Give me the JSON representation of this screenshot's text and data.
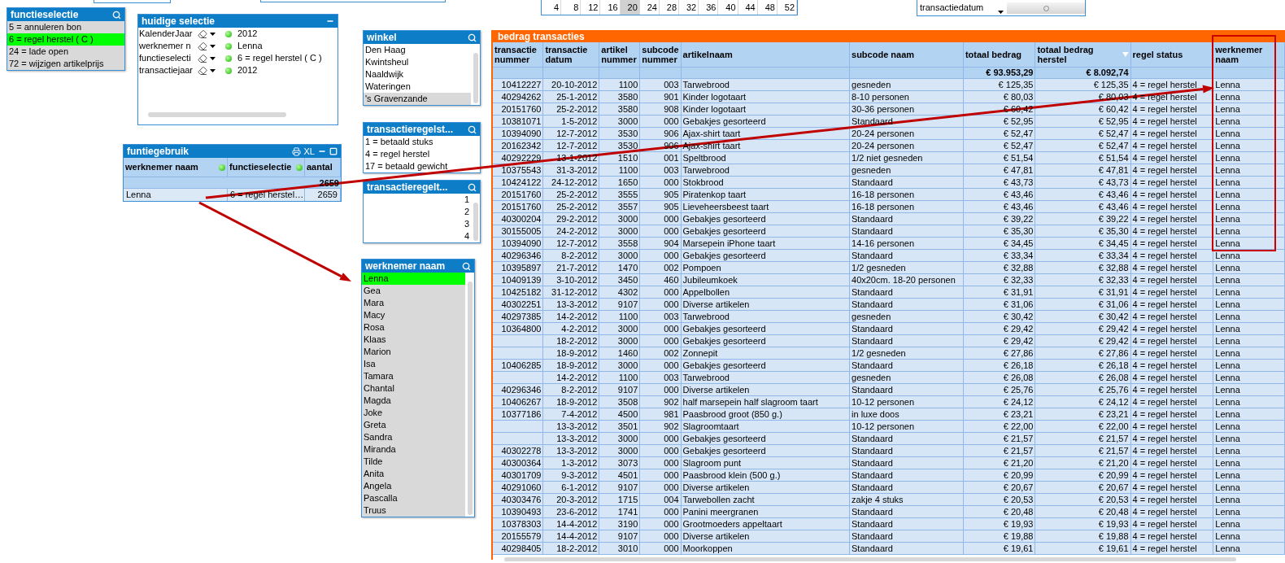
{
  "week_numbers": [
    {
      "label": "4",
      "selected": false
    },
    {
      "label": "8",
      "selected": false
    },
    {
      "label": "12",
      "selected": false
    },
    {
      "label": "16",
      "selected": false
    },
    {
      "label": "20",
      "selected": true
    },
    {
      "label": "24",
      "selected": false
    },
    {
      "label": "28",
      "selected": false
    },
    {
      "label": "32",
      "selected": false
    },
    {
      "label": "36",
      "selected": false
    },
    {
      "label": "40",
      "selected": false
    },
    {
      "label": "44",
      "selected": false
    },
    {
      "label": "48",
      "selected": false
    },
    {
      "label": "52",
      "selected": false
    }
  ],
  "date_field": {
    "label": "transactiedatum"
  },
  "functieselectie": {
    "title": "functieselectie",
    "items": [
      {
        "label": "5 = annuleren bon",
        "selected": false,
        "excluded": true
      },
      {
        "label": "6 = regel herstel ( C )",
        "selected": true,
        "excluded": false
      },
      {
        "label": "24 = lade open",
        "selected": false,
        "excluded": true
      },
      {
        "label": "72 = wijzigen artikelprijs",
        "selected": false,
        "excluded": true
      }
    ]
  },
  "huidige_selectie": {
    "title": "huidige selectie",
    "rows": [
      {
        "field": "KalenderJaar",
        "value": "2012"
      },
      {
        "field": "werknemer n",
        "value": "Lenna"
      },
      {
        "field": "functieselecti",
        "value": "6 = regel herstel ( C )"
      },
      {
        "field": "transactiejaar",
        "value": "2012"
      }
    ]
  },
  "winkel": {
    "title": "winkel",
    "items": [
      {
        "label": "Den Haag",
        "selected": false,
        "excluded": false
      },
      {
        "label": "Kwintsheul",
        "selected": false,
        "excluded": false
      },
      {
        "label": "Naaldwijk",
        "selected": false,
        "excluded": false
      },
      {
        "label": "Wateringen",
        "selected": false,
        "excluded": false
      },
      {
        "label": "'s Gravenzande",
        "selected": false,
        "excluded": true
      }
    ]
  },
  "transactieregelstatus": {
    "title": "transactieregelst...",
    "items": [
      {
        "label": "1 = betaald stuks",
        "selected": false,
        "excluded": false
      },
      {
        "label": "4 = regel herstel",
        "selected": false,
        "excluded": false
      },
      {
        "label": "17 = betaald gewicht",
        "selected": false,
        "excluded": false
      }
    ]
  },
  "transactieregeltype": {
    "title": "transactieregelt...",
    "items": [
      {
        "label": "1",
        "selected": false,
        "excluded": false
      },
      {
        "label": "2",
        "selected": false,
        "excluded": false
      },
      {
        "label": "3",
        "selected": false,
        "excluded": false
      },
      {
        "label": "4",
        "selected": false,
        "excluded": false
      }
    ]
  },
  "funtiegebruik": {
    "title": "funtiegebruik",
    "export_label": "XL",
    "columns": [
      "werknemer naam",
      "functieselectie",
      "aantal"
    ],
    "total": "2659",
    "rows": [
      [
        "Lenna",
        "6 = regel herstel…",
        "2659"
      ]
    ]
  },
  "werknemer_naam": {
    "title": "werknemer naam",
    "items": [
      {
        "label": "Lenna",
        "selected": true,
        "excluded": false
      },
      {
        "label": "Gea",
        "selected": false,
        "excluded": true
      },
      {
        "label": "Mara",
        "selected": false,
        "excluded": true
      },
      {
        "label": "Macy",
        "selected": false,
        "excluded": true
      },
      {
        "label": "Rosa",
        "selected": false,
        "excluded": true
      },
      {
        "label": "Klaas",
        "selected": false,
        "excluded": true
      },
      {
        "label": "Marion",
        "selected": false,
        "excluded": true
      },
      {
        "label": "Isa",
        "selected": false,
        "excluded": true
      },
      {
        "label": "Tamara",
        "selected": false,
        "excluded": true
      },
      {
        "label": "Chantal",
        "selected": false,
        "excluded": true
      },
      {
        "label": "Magda",
        "selected": false,
        "excluded": true
      },
      {
        "label": "Joke",
        "selected": false,
        "excluded": true
      },
      {
        "label": "Greta",
        "selected": false,
        "excluded": true
      },
      {
        "label": "Sandra",
        "selected": false,
        "excluded": true
      },
      {
        "label": "Miranda",
        "selected": false,
        "excluded": true
      },
      {
        "label": "Tilde",
        "selected": false,
        "excluded": true
      },
      {
        "label": "Anita",
        "selected": false,
        "excluded": true
      },
      {
        "label": "Angela",
        "selected": false,
        "excluded": true
      },
      {
        "label": "Pascalla",
        "selected": false,
        "excluded": true
      },
      {
        "label": "Truus",
        "selected": false,
        "excluded": true
      }
    ]
  },
  "transactions": {
    "title": "bedrag transacties",
    "columns": [
      {
        "label": "transactie nummer",
        "kind": "number",
        "sorted": false
      },
      {
        "label": "transactie datum",
        "kind": "number",
        "sorted": false
      },
      {
        "label": "artikel nummer",
        "kind": "number",
        "sorted": false
      },
      {
        "label": "subcode nummer",
        "kind": "number",
        "sorted": false
      },
      {
        "label": "artikelnaam",
        "kind": "text",
        "sorted": false
      },
      {
        "label": "subcode naam",
        "kind": "text",
        "sorted": false
      },
      {
        "label": "totaal bedrag",
        "kind": "number",
        "total": "€ 93.953,29",
        "sorted": false
      },
      {
        "label": "totaal bedrag herstel",
        "kind": "number",
        "total": "€ 8.092,74",
        "sorted": true
      },
      {
        "label": "regel status",
        "kind": "text",
        "sorted": false
      },
      {
        "label": "werknemer naam",
        "kind": "text",
        "sorted": false
      }
    ],
    "rows": [
      [
        "10412227",
        "20-10-2012",
        "1100",
        "003",
        "Tarwebrood",
        "gesneden",
        "€ 125,35",
        "€ 125,35",
        "4 = regel herstel",
        "Lenna"
      ],
      [
        "40294262",
        "25-1-2012",
        "3580",
        "901",
        "Kinder logotaart",
        "8-10 personen",
        "€ 80,03",
        "€ 80,03",
        "4 = regel herstel",
        "Lenna"
      ],
      [
        "20151760",
        "25-2-2012",
        "3580",
        "908",
        "Kinder logotaart",
        "30-36 personen",
        "€ 60,42",
        "€ 60,42",
        "4 = regel herstel",
        "Lenna"
      ],
      [
        "10381071",
        "1-5-2012",
        "3000",
        "000",
        "Gebakjes gesorteerd",
        "Standaard",
        "€ 52,95",
        "€ 52,95",
        "4 = regel herstel",
        "Lenna"
      ],
      [
        "10394090",
        "12-7-2012",
        "3530",
        "906",
        "Ajax-shirt taart",
        "20-24 personen",
        "€ 52,47",
        "€ 52,47",
        "4 = regel herstel",
        "Lenna"
      ],
      [
        "20162342",
        "12-7-2012",
        "3530",
        "906",
        "Ajax-shirt taart",
        "20-24 personen",
        "€ 52,47",
        "€ 52,47",
        "4 = regel herstel",
        "Lenna"
      ],
      [
        "40292229",
        "13-1-2012",
        "1510",
        "001",
        "Speltbrood",
        "1/2  niet gesneden",
        "€ 51,54",
        "€ 51,54",
        "4 = regel herstel",
        "Lenna"
      ],
      [
        "10375543",
        "31-3-2012",
        "1100",
        "003",
        "Tarwebrood",
        "gesneden",
        "€ 47,81",
        "€ 47,81",
        "4 = regel herstel",
        "Lenna"
      ],
      [
        "10424122",
        "24-12-2012",
        "1650",
        "000",
        "Stokbrood",
        "Standaard",
        "€ 43,73",
        "€ 43,73",
        "4 = regel herstel",
        "Lenna"
      ],
      [
        "20151760",
        "25-2-2012",
        "3555",
        "905",
        "Piratenkop taart",
        "16-18 personen",
        "€ 43,46",
        "€ 43,46",
        "4 = regel herstel",
        "Lenna"
      ],
      [
        "20151760",
        "25-2-2012",
        "3557",
        "905",
        "Lieveheersbeest taart",
        "16-18 personen",
        "€ 43,46",
        "€ 43,46",
        "4 = regel herstel",
        "Lenna"
      ],
      [
        "40300204",
        "29-2-2012",
        "3000",
        "000",
        "Gebakjes gesorteerd",
        "Standaard",
        "€ 39,22",
        "€ 39,22",
        "4 = regel herstel",
        "Lenna"
      ],
      [
        "30155005",
        "24-2-2012",
        "3000",
        "000",
        "Gebakjes gesorteerd",
        "Standaard",
        "€ 35,30",
        "€ 35,30",
        "4 = regel herstel",
        "Lenna"
      ],
      [
        "10394090",
        "12-7-2012",
        "3558",
        "904",
        "Marsepein iPhone taart",
        "14-16 personen",
        "€ 34,45",
        "€ 34,45",
        "4 = regel herstel",
        "Lenna"
      ],
      [
        "40296346",
        "8-2-2012",
        "3000",
        "000",
        "Gebakjes gesorteerd",
        "Standaard",
        "€ 33,34",
        "€ 33,34",
        "4 = regel herstel",
        "Lenna"
      ],
      [
        "10395897",
        "21-7-2012",
        "1470",
        "002",
        "Pompoen",
        "1/2 gesneden",
        "€ 32,88",
        "€ 32,88",
        "4 = regel herstel",
        "Lenna"
      ],
      [
        "10409139",
        "3-10-2012",
        "3450",
        "460",
        "Jubileumkoek",
        "40x20cm. 18-20 personen",
        "€ 32,33",
        "€ 32,33",
        "4 = regel herstel",
        "Lenna"
      ],
      [
        "10425182",
        "31-12-2012",
        "4302",
        "000",
        "Appelbollen",
        "Standaard",
        "€ 31,91",
        "€ 31,91",
        "4 = regel herstel",
        "Lenna"
      ],
      [
        "40302251",
        "13-3-2012",
        "9107",
        "000",
        "Diverse artikelen",
        "Standaard",
        "€ 31,06",
        "€ 31,06",
        "4 = regel herstel",
        "Lenna"
      ],
      [
        "40297385",
        "14-2-2012",
        "1100",
        "003",
        "Tarwebrood",
        "gesneden",
        "€ 30,42",
        "€ 30,42",
        "4 = regel herstel",
        "Lenna"
      ],
      [
        "10364800",
        "4-2-2012",
        "3000",
        "000",
        "Gebakjes gesorteerd",
        "Standaard",
        "€ 29,42",
        "€ 29,42",
        "4 = regel herstel",
        "Lenna"
      ],
      [
        null,
        "18-2-2012",
        "3000",
        "000",
        "Gebakjes gesorteerd",
        "Standaard",
        "€ 29,42",
        "€ 29,42",
        "4 = regel herstel",
        "Lenna"
      ],
      [
        null,
        "18-9-2012",
        "1460",
        "002",
        "Zonnepit",
        "1/2 gesneden",
        "€ 27,86",
        "€ 27,86",
        "4 = regel herstel",
        "Lenna"
      ],
      [
        "10406285",
        "18-9-2012",
        "3000",
        "000",
        "Gebakjes gesorteerd",
        "Standaard",
        "€ 26,18",
        "€ 26,18",
        "4 = regel herstel",
        "Lenna"
      ],
      [
        null,
        "14-2-2012",
        "1100",
        "003",
        "Tarwebrood",
        "gesneden",
        "€ 26,08",
        "€ 26,08",
        "4 = regel herstel",
        "Lenna"
      ],
      [
        "40296346",
        "8-2-2012",
        "9107",
        "000",
        "Diverse artikelen",
        "Standaard",
        "€ 25,76",
        "€ 25,76",
        "4 = regel herstel",
        "Lenna"
      ],
      [
        "10406267",
        "18-9-2012",
        "3508",
        "902",
        "half marsepein half slagroom taart",
        "10-12 personen",
        "€ 24,12",
        "€ 24,12",
        "4 = regel herstel",
        "Lenna"
      ],
      [
        "10377186",
        "7-4-2012",
        "4500",
        "981",
        "Paasbrood groot (850 g.)",
        "in luxe doos",
        "€ 23,21",
        "€ 23,21",
        "4 = regel herstel",
        "Lenna"
      ],
      [
        null,
        "13-3-2012",
        "3501",
        "902",
        "Slagroomtaart",
        "10-12 personen",
        "€ 22,00",
        "€ 22,00",
        "4 = regel herstel",
        "Lenna"
      ],
      [
        null,
        "13-3-2012",
        "3000",
        "000",
        "Gebakjes gesorteerd",
        "Standaard",
        "€ 21,57",
        "€ 21,57",
        "4 = regel herstel",
        "Lenna"
      ],
      [
        "40302278",
        "13-3-2012",
        "3000",
        "000",
        "Gebakjes gesorteerd",
        "Standaard",
        "€ 21,57",
        "€ 21,57",
        "4 = regel herstel",
        "Lenna"
      ],
      [
        "40300364",
        "1-3-2012",
        "3073",
        "000",
        "Slagroom punt",
        "Standaard",
        "€ 21,20",
        "€ 21,20",
        "4 = regel herstel",
        "Lenna"
      ],
      [
        "40301709",
        "9-3-2012",
        "4501",
        "000",
        "Paasbrood klein (500 g.)",
        "Standaard",
        "€ 20,99",
        "€ 20,99",
        "4 = regel herstel",
        "Lenna"
      ],
      [
        "40291060",
        "6-1-2012",
        "9107",
        "000",
        "Diverse artikelen",
        "Standaard",
        "€ 20,67",
        "€ 20,67",
        "4 = regel herstel",
        "Lenna"
      ],
      [
        "40303476",
        "20-3-2012",
        "1715",
        "004",
        "Tarwebollen zacht",
        "zakje 4 stuks",
        "€ 20,53",
        "€ 20,53",
        "4 = regel herstel",
        "Lenna"
      ],
      [
        "10390493",
        "23-6-2012",
        "1741",
        "000",
        "Panini meergranen",
        "Standaard",
        "€ 20,48",
        "€ 20,48",
        "4 = regel herstel",
        "Lenna"
      ],
      [
        "10378303",
        "14-4-2012",
        "3190",
        "000",
        "Grootmoeders appeltaart",
        "Standaard",
        "€ 19,93",
        "€ 19,93",
        "4 = regel herstel",
        "Lenna"
      ],
      [
        "20155579",
        "14-4-2012",
        "9107",
        "000",
        "Diverse artikelen",
        "Standaard",
        "€ 19,88",
        "€ 19,88",
        "4 = regel herstel",
        "Lenna"
      ],
      [
        "40298405",
        "18-2-2012",
        "3010",
        "000",
        "Moorkoppen",
        "Standaard",
        "€ 19,61",
        "€ 19,61",
        "4 = regel herstel",
        "Lenna"
      ]
    ]
  }
}
